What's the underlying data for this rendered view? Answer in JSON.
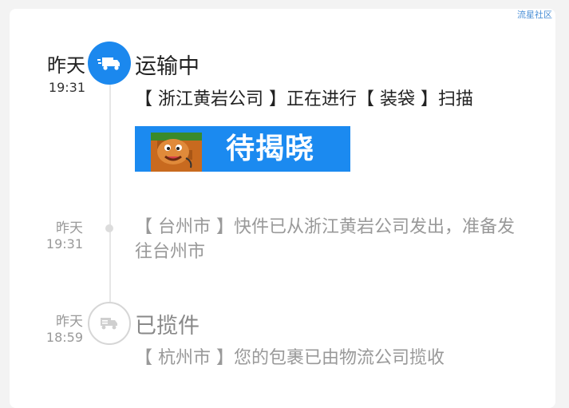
{
  "watermark": "流星社区",
  "events": [
    {
      "day": "昨天",
      "time": "19:31",
      "status": "运输中",
      "description": "【 浙江黄岩公司 】正在进行【 装袋 】扫描",
      "banner_label": "待揭晓",
      "icon": "truck-icon"
    },
    {
      "day": "昨天",
      "time": "19:31",
      "status": "",
      "description": "【 台州市 】快件已从浙江黄岩公司发出，准备发往台州市",
      "icon": "dot"
    },
    {
      "day": "昨天",
      "time": "18:59",
      "status": "已揽件",
      "description": "【 杭州市 】您的包裹已由物流公司揽收",
      "icon": "truck-icon"
    }
  ],
  "colors": {
    "accent": "#1b88ee",
    "banner": "#1b8af0",
    "inactive_text": "#999999"
  }
}
